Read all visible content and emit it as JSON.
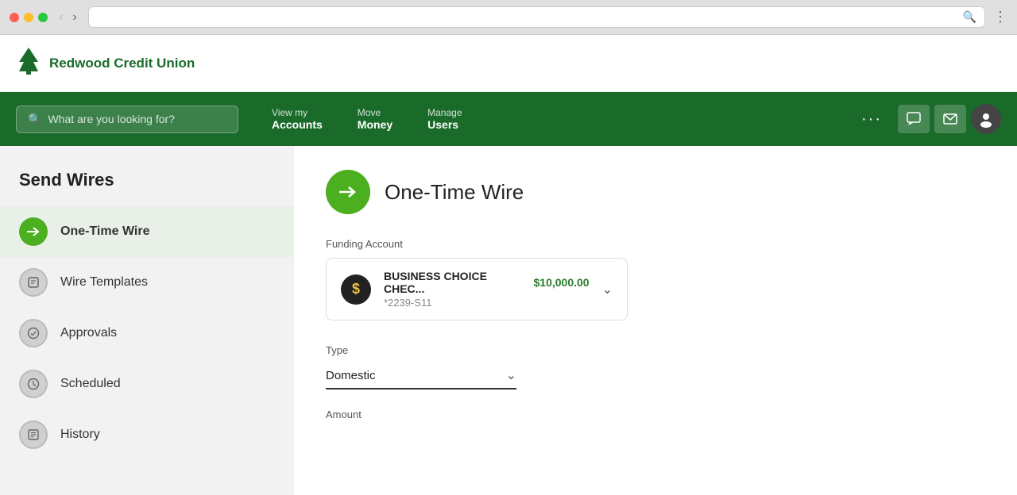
{
  "browser": {
    "address_bar_text": ""
  },
  "header": {
    "logo_text": "Redwood Credit Union",
    "logo_icon": "🌲"
  },
  "navbar": {
    "search_placeholder": "What are you looking for?",
    "nav_items": [
      {
        "top": "View my",
        "bottom": "Accounts"
      },
      {
        "top": "Move",
        "bottom": "Money"
      },
      {
        "top": "Manage",
        "bottom": "Users"
      }
    ],
    "more_label": "···"
  },
  "sidebar": {
    "title": "Send Wires",
    "items": [
      {
        "label": "One-Time Wire",
        "icon_type": "green-arrow",
        "active": true
      },
      {
        "label": "Wire Templates",
        "icon_type": "gray-box"
      },
      {
        "label": "Approvals",
        "icon_type": "gray-check-circle"
      },
      {
        "label": "Scheduled",
        "icon_type": "gray-clock"
      },
      {
        "label": "History",
        "icon_type": "gray-list"
      }
    ]
  },
  "main": {
    "page_title": "One-Time Wire",
    "funding_account_label": "Funding Account",
    "account": {
      "name": "BUSINESS CHOICE CHEC...",
      "amount": "$10,000.00",
      "number": "*2239-S11"
    },
    "type_label": "Type",
    "type_value": "Domestic",
    "amount_label": "Amount"
  }
}
